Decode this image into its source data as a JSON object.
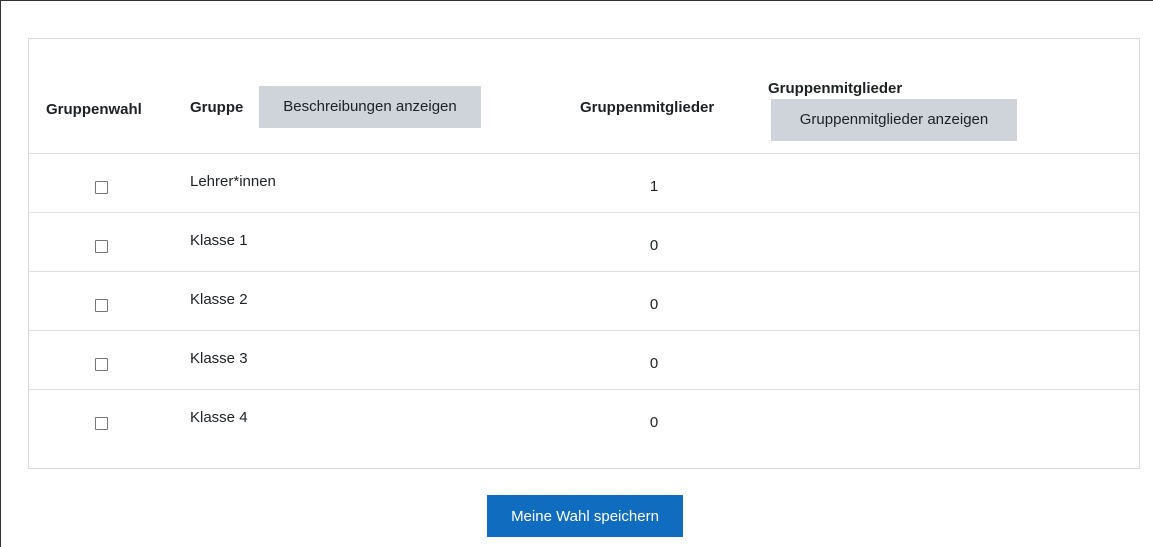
{
  "table": {
    "headers": {
      "selection": "Gruppenwahl",
      "group": "Gruppe",
      "members_count": "Gruppenmitglieder",
      "members_list": "Gruppenmitglieder"
    },
    "buttons": {
      "show_descriptions": "Beschreibungen anzeigen",
      "show_members": "Gruppenmitglieder anzeigen"
    },
    "rows": [
      {
        "name": "Lehrer*innen",
        "count": "1",
        "checked": false
      },
      {
        "name": "Klasse 1",
        "count": "0",
        "checked": false
      },
      {
        "name": "Klasse 2",
        "count": "0",
        "checked": false
      },
      {
        "name": "Klasse 3",
        "count": "0",
        "checked": false
      },
      {
        "name": "Klasse 4",
        "count": "0",
        "checked": false
      }
    ]
  },
  "actions": {
    "save_label": "Meine Wahl speichern"
  },
  "colors": {
    "primary": "#0f6cbf",
    "secondary_button": "#ced4da",
    "border": "#dfe1e4"
  }
}
